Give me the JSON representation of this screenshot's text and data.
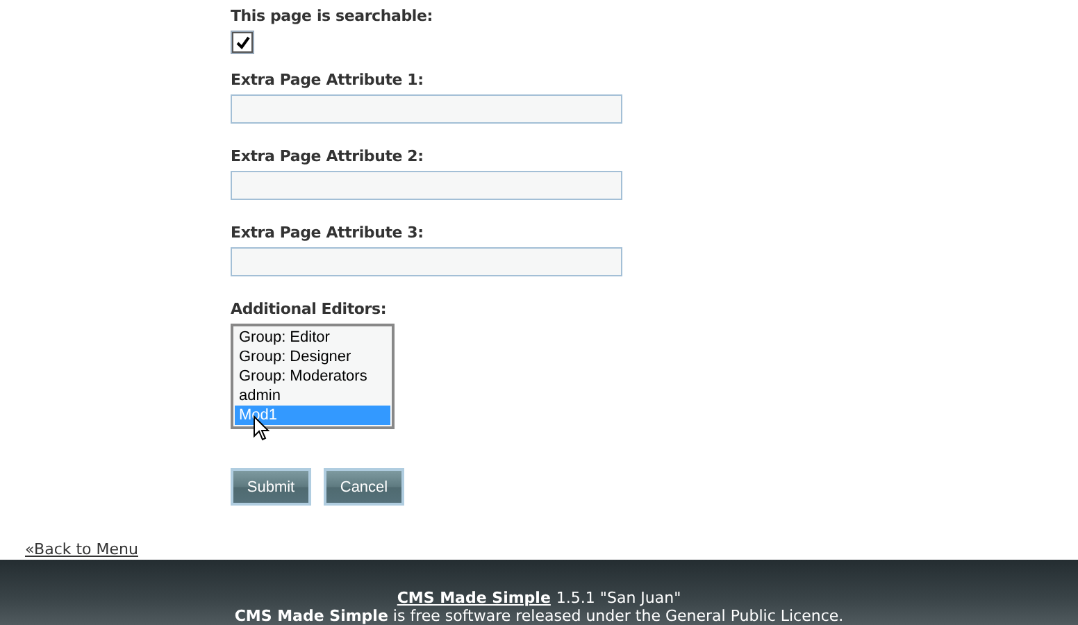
{
  "form": {
    "searchable": {
      "label": "This page is searchable:",
      "checked": true
    },
    "fields": [
      {
        "label": "Extra Page Attribute 1:"
      },
      {
        "label": "Extra Page Attribute 2:"
      },
      {
        "label": "Extra Page Attribute 3:"
      }
    ],
    "editors": {
      "label": "Additional Editors:",
      "options": [
        {
          "text": "Group: Editor",
          "selected": false
        },
        {
          "text": "Group: Designer",
          "selected": false
        },
        {
          "text": "Group: Moderators",
          "selected": false
        },
        {
          "text": "admin",
          "selected": false
        },
        {
          "text": "Mod1",
          "selected": true
        }
      ]
    },
    "buttons": [
      "Submit",
      "Cancel"
    ]
  },
  "back_link": "«Back to Menu",
  "footer": {
    "link": "CMS Made Simple",
    "version": "1.5.1 \"San Juan\"",
    "licence": "**CMS Made Simple** is free software released under the General Public Licence."
  }
}
